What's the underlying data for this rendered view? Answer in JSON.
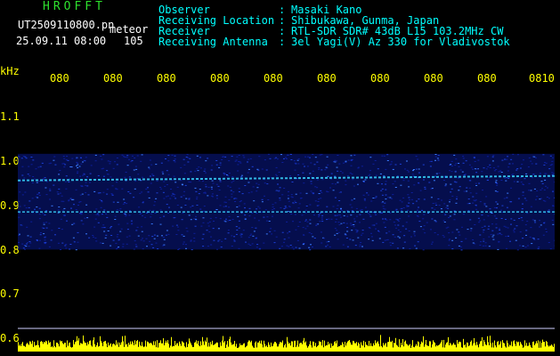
{
  "header": {
    "app_name": "HROFFT",
    "filename": "UT2509110800.pn",
    "mode": "meteor",
    "datetime": "25.09.11 08:00",
    "count": "105",
    "fields": [
      {
        "label": "Observer",
        "sep": ":",
        "value": "Masaki Kano"
      },
      {
        "label": "Receiving Location",
        "sep": ":",
        "value": "Shibukawa, Gunma, Japan"
      },
      {
        "label": "Receiver",
        "sep": ":",
        "value": "RTL-SDR SDR# 43dB L15 103.2MHz CW"
      },
      {
        "label": "Receiving Antenna",
        "sep": ":",
        "value": "3el Yagi(V) Az 330 for Vladivostok"
      }
    ]
  },
  "axis": {
    "unit": "kHz",
    "y_ticks": [
      "1.1",
      "1.0",
      "0.9",
      "0.8",
      "0.7",
      "0.6"
    ],
    "x_ticks": [
      "080",
      "080",
      "080",
      "080",
      "080",
      "080",
      "080",
      "080",
      "080",
      "0810"
    ]
  },
  "colors": {
    "background": "#000000",
    "tick_label": "#ffff00",
    "header_label": "#00ffff",
    "app_name": "#2ee02e",
    "noise": "#0a1a8c",
    "signal": "#39d6ff",
    "activity": "#ffff00"
  },
  "chart_data": {
    "type": "heatmap",
    "ylabel": "kHz",
    "ylim": [
      0.6,
      1.1
    ],
    "noise_band_khz": [
      0.8,
      1.0
    ],
    "signal_lines_khz": [
      0.96,
      0.885
    ]
  }
}
